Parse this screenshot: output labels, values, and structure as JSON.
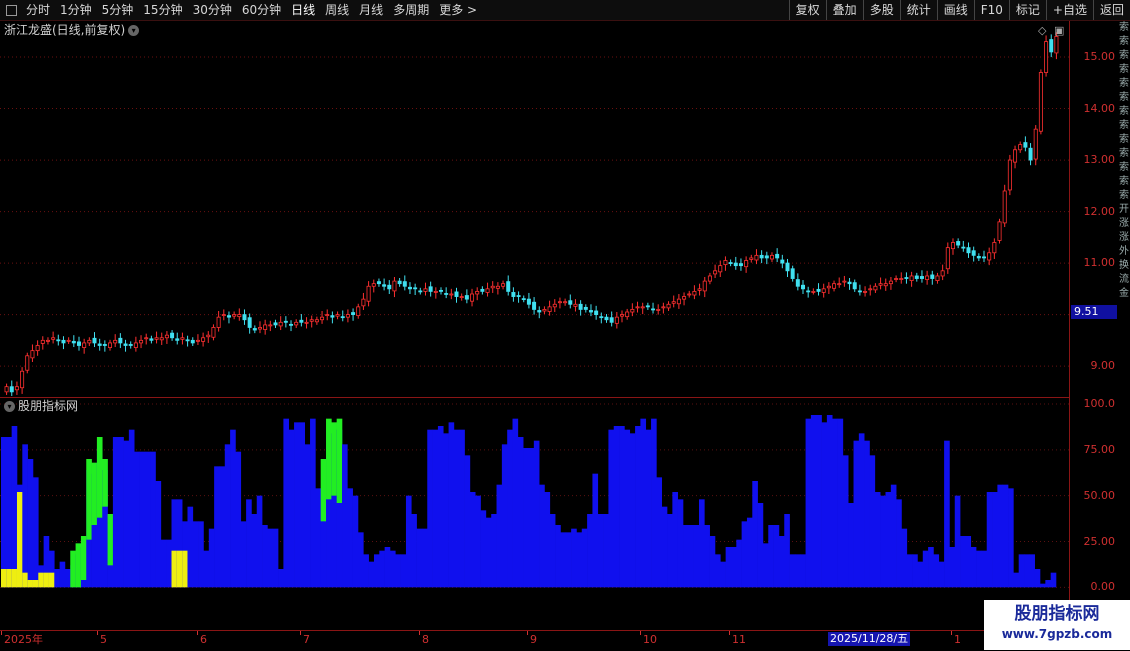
{
  "toolbar": {
    "periods": [
      "分时",
      "1分钟",
      "5分钟",
      "15分钟",
      "30分钟",
      "60分钟",
      "日线",
      "周线",
      "月线",
      "多周期",
      "更多 >"
    ],
    "active_period": "日线",
    "right_buttons": [
      "复权",
      "叠加",
      "多股",
      "统计",
      "画线",
      "F10",
      "标记",
      "+自选",
      "返回"
    ]
  },
  "chart": {
    "title": "浙江龙盛(日线,前复权)",
    "sub_title": "股朋指标网",
    "current_price": "9.51",
    "y_labels": [
      "15.00",
      "14.00",
      "13.00",
      "12.00",
      "11.00",
      "10.00",
      "9.00"
    ],
    "sub_y_labels": [
      "100.0",
      "75.00",
      "50.00",
      "25.00",
      "0.00"
    ],
    "x_labels": [
      "2025年",
      "5",
      "6",
      "7",
      "8",
      "9",
      "10",
      "11",
      "1"
    ],
    "x_selected": "2025/11/28/五",
    "right_strip": [
      "索",
      "索",
      "索",
      "索",
      "索",
      "索",
      "索",
      "索",
      "索",
      "索",
      "索",
      "索",
      "索",
      "开",
      "涨",
      "涨",
      "外",
      "换",
      "流",
      "金"
    ]
  },
  "watermark": {
    "line1": "股朋指标网",
    "line2": "www.7gpzb.com"
  },
  "chart_data": [
    {
      "type": "candlestick",
      "title": "浙江龙盛(日线,前复权)",
      "ylim": [
        8.4,
        15.7
      ],
      "close": [
        8.6,
        8.5,
        8.6,
        8.9,
        9.2,
        9.3,
        9.4,
        9.5,
        9.5,
        9.55,
        9.5,
        9.45,
        9.5,
        9.45,
        9.4,
        9.45,
        9.5,
        9.45,
        9.4,
        9.4,
        9.45,
        9.5,
        9.45,
        9.4,
        9.4,
        9.45,
        9.5,
        9.55,
        9.5,
        9.55,
        9.55,
        9.6,
        9.55,
        9.5,
        9.55,
        9.5,
        9.45,
        9.5,
        9.55,
        9.6,
        9.75,
        9.95,
        10.0,
        9.95,
        10.0,
        10.0,
        9.9,
        9.75,
        9.7,
        9.75,
        9.8,
        9.8,
        9.8,
        9.85,
        9.85,
        9.8,
        9.85,
        9.85,
        9.85,
        9.9,
        9.9,
        9.95,
        10.0,
        9.95,
        10.0,
        9.95,
        10.0,
        10.0,
        10.15,
        10.3,
        10.55,
        10.6,
        10.6,
        10.55,
        10.5,
        10.65,
        10.6,
        10.55,
        10.5,
        10.5,
        10.45,
        10.5,
        10.45,
        10.45,
        10.45,
        10.4,
        10.4,
        10.35,
        10.35,
        10.3,
        10.4,
        10.45,
        10.45,
        10.5,
        10.55,
        10.55,
        10.6,
        10.45,
        10.35,
        10.35,
        10.3,
        10.2,
        10.1,
        10.05,
        10.1,
        10.15,
        10.2,
        10.25,
        10.25,
        10.2,
        10.2,
        10.1,
        10.1,
        10.05,
        10.0,
        9.95,
        9.9,
        9.85,
        9.95,
        10.0,
        10.05,
        10.1,
        10.15,
        10.15,
        10.15,
        10.1,
        10.1,
        10.15,
        10.2,
        10.25,
        10.3,
        10.35,
        10.4,
        10.45,
        10.5,
        10.65,
        10.75,
        10.85,
        10.95,
        11.05,
        11.0,
        10.95,
        10.95,
        11.05,
        11.1,
        11.15,
        11.1,
        11.1,
        11.15,
        11.1,
        11.0,
        10.85,
        10.7,
        10.55,
        10.5,
        10.45,
        10.45,
        10.45,
        10.5,
        10.55,
        10.6,
        10.6,
        10.65,
        10.6,
        10.5,
        10.45,
        10.45,
        10.5,
        10.55,
        10.6,
        10.6,
        10.65,
        10.7,
        10.7,
        10.7,
        10.75,
        10.7,
        10.7,
        10.75,
        10.7,
        10.75,
        10.85,
        11.3,
        11.4,
        11.35,
        11.3,
        11.2,
        11.15,
        11.1,
        11.1,
        11.2,
        11.4,
        11.8,
        12.4,
        13.0,
        13.2,
        13.3,
        13.25,
        13.0,
        13.6,
        14.7,
        15.3,
        15.1,
        15.4
      ]
    },
    {
      "type": "bar",
      "title": "股朋指标网",
      "ylim": [
        -20,
        100
      ],
      "series": [
        {
          "color": "#1010ee",
          "values": [
            82,
            82,
            88,
            56,
            78,
            70,
            60,
            12,
            28,
            20,
            10,
            14,
            10,
            12,
            18,
            22,
            64,
            62,
            76,
            64,
            34,
            82,
            82,
            80,
            86,
            74,
            74,
            74,
            74,
            58,
            26,
            26,
            48,
            48,
            36,
            44,
            36,
            36,
            20,
            32,
            66,
            66,
            78,
            86,
            74,
            36,
            48,
            40,
            50,
            34,
            32,
            32,
            10,
            92,
            86,
            90,
            90,
            78,
            92,
            54,
            54,
            86,
            84,
            86,
            78,
            54,
            50,
            30,
            18,
            14,
            18,
            20,
            22,
            20,
            18,
            18,
            50,
            40,
            32,
            32,
            86,
            86,
            88,
            84,
            90,
            86,
            86,
            72,
            52,
            50,
            42,
            38,
            40,
            56,
            78,
            86,
            92,
            82,
            76,
            76,
            80,
            56,
            52,
            40,
            34,
            30,
            30,
            32,
            30,
            32,
            40,
            62,
            40,
            40,
            86,
            88,
            88,
            86,
            84,
            88,
            92,
            86,
            92,
            60,
            44,
            40,
            52,
            48,
            34,
            34,
            34,
            48,
            34,
            28,
            18,
            14,
            22,
            22,
            26,
            36,
            38,
            58,
            46,
            24,
            34,
            34,
            28,
            40,
            18,
            18,
            18,
            92,
            94,
            94,
            90,
            94,
            92,
            92,
            72,
            46,
            80,
            84,
            80,
            72,
            52,
            50,
            52,
            56,
            48,
            32,
            18,
            18,
            14,
            20,
            22,
            18,
            14,
            80,
            22,
            50,
            28,
            28,
            22,
            20,
            20,
            52,
            52,
            56,
            56,
            54,
            8,
            18,
            18,
            18,
            10,
            2,
            4,
            8
          ]
        },
        {
          "color": "#22ee22",
          "values": [
            0,
            0,
            0,
            0,
            0,
            0,
            0,
            0,
            0,
            0,
            0,
            0,
            0,
            14,
            18,
            22,
            44,
            52,
            56,
            62,
            30,
            0,
            0,
            0,
            0,
            0,
            0,
            0,
            0,
            0,
            0,
            0,
            0,
            0,
            0,
            0,
            0,
            0,
            0,
            0,
            0,
            0,
            0,
            0,
            0,
            0,
            0,
            0,
            0,
            0,
            0,
            0,
            0,
            0,
            0,
            0,
            0,
            0,
            0,
            0,
            64,
            66,
            68,
            64,
            0,
            0,
            0,
            0,
            0,
            0,
            0,
            0,
            0,
            0,
            0,
            0,
            0,
            0,
            0,
            0,
            0,
            0,
            0,
            0,
            0,
            0,
            0,
            0,
            0,
            0,
            0,
            0,
            0,
            0,
            0,
            0,
            0,
            0,
            0,
            0,
            0,
            0,
            0,
            0,
            0,
            0,
            0,
            0,
            0,
            0,
            0,
            0,
            0,
            0,
            0,
            0,
            0,
            0,
            0,
            0,
            0,
            0,
            0,
            0,
            0,
            0,
            0,
            0,
            0,
            0,
            0,
            0,
            0,
            0,
            0,
            0,
            0,
            0,
            0,
            0,
            0,
            0,
            0,
            0,
            0,
            0,
            0,
            0,
            0,
            0,
            0,
            0,
            0,
            0,
            0,
            0,
            0,
            0,
            0,
            0,
            0,
            0,
            0,
            0,
            0,
            0,
            0,
            0,
            0,
            0,
            0,
            0,
            0,
            0,
            0,
            0,
            0,
            0,
            0,
            0,
            0,
            0,
            0,
            0,
            0,
            0,
            0,
            0,
            0,
            0,
            0,
            0,
            0,
            0,
            0,
            0,
            0,
            0,
            0,
            0
          ]
        },
        {
          "color": "#eeee11",
          "values": [
            10,
            10,
            10,
            52,
            8,
            4,
            4,
            8,
            8,
            8,
            0,
            0,
            0,
            0,
            0,
            0,
            0,
            0,
            0,
            0,
            0,
            0,
            0,
            0,
            0,
            0,
            0,
            0,
            0,
            0,
            0,
            0,
            20,
            20,
            20,
            0,
            0,
            0,
            0,
            0,
            0,
            0,
            0,
            0,
            0,
            0,
            0,
            0,
            0,
            0,
            0,
            0,
            0,
            0,
            0,
            0,
            0,
            0,
            0,
            0,
            0,
            0,
            0,
            0,
            0,
            0,
            0,
            0,
            0,
            0,
            0,
            0,
            0,
            0,
            0,
            0,
            0,
            0,
            0,
            0,
            0,
            0,
            0,
            0,
            0,
            0,
            0,
            0,
            0,
            0,
            0,
            0,
            0,
            0,
            0,
            0,
            0,
            0,
            0,
            0,
            0,
            0,
            0,
            0,
            0,
            0,
            0,
            0,
            0,
            0,
            0,
            0,
            0,
            0,
            0,
            0,
            0,
            0,
            0,
            0,
            0,
            0,
            0,
            0,
            0,
            0,
            0,
            0,
            0,
            0,
            0,
            0,
            0,
            0,
            0,
            0,
            0,
            0,
            0,
            0,
            0,
            0,
            0,
            0,
            0,
            0,
            0,
            0,
            0,
            0,
            0,
            0,
            0,
            0,
            0,
            0,
            0,
            0,
            0,
            0,
            0,
            0,
            0,
            0,
            0,
            0,
            0,
            0,
            0,
            0,
            0,
            0,
            0,
            0,
            0,
            0,
            0,
            0,
            0,
            0,
            0,
            0,
            0,
            0,
            0,
            0,
            0,
            0,
            0,
            0,
            0,
            0,
            0,
            0,
            0,
            0,
            0
          ]
        }
      ]
    }
  ]
}
